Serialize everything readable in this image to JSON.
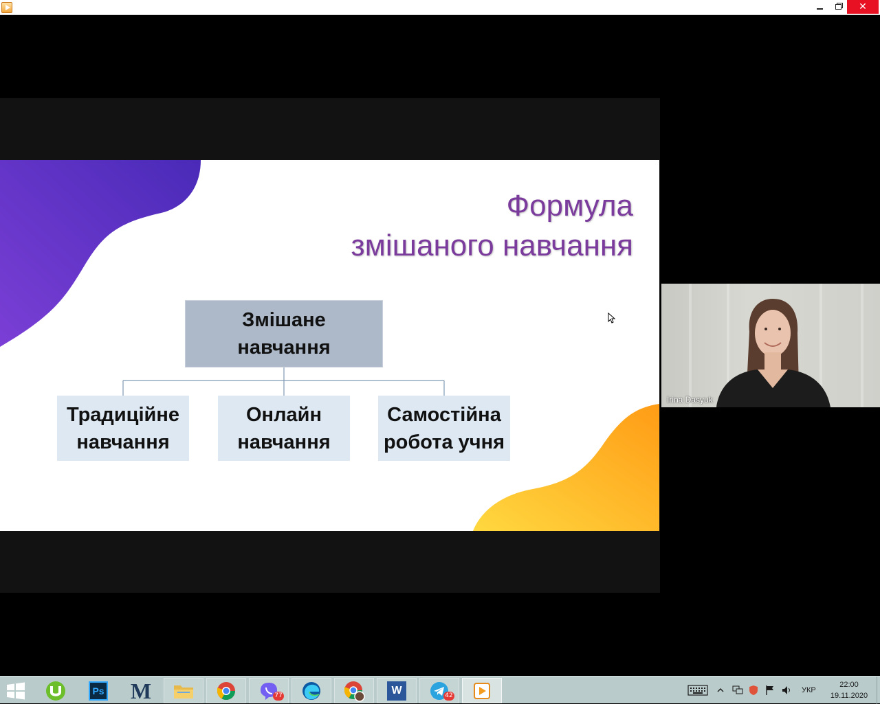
{
  "window": {
    "close_glyph": "✕"
  },
  "slide": {
    "title_line1": "Формула",
    "title_line2": "змішаного навчання",
    "root": {
      "line1": "Змішане",
      "line2": "навчання"
    },
    "children": [
      {
        "line1": "Традиційне",
        "line2": "навчання"
      },
      {
        "line1": "Онлайн",
        "line2": "навчання"
      },
      {
        "line1": "Самостійна",
        "line2": "робота учня"
      }
    ],
    "title_color": "#7a3b9c",
    "blob_purple": [
      "#5b2fc9",
      "#7b3fd6"
    ],
    "blob_orange": [
      "#ffcf3a",
      "#ff9f1a"
    ]
  },
  "webcam": {
    "participant_name": "Irina Dasyuk"
  },
  "taskbar": {
    "apps": [
      {
        "name": "utorrent",
        "badge": ""
      },
      {
        "name": "photoshop",
        "label": "Ps",
        "badge": ""
      },
      {
        "name": "mendeley",
        "label": "M",
        "badge": ""
      },
      {
        "name": "file-explorer",
        "badge": ""
      },
      {
        "name": "chrome",
        "badge": ""
      },
      {
        "name": "viber",
        "badge": "77"
      },
      {
        "name": "edge",
        "badge": ""
      },
      {
        "name": "chrome-profile",
        "badge": ""
      },
      {
        "name": "word",
        "label": "W",
        "badge": ""
      },
      {
        "name": "telegram",
        "badge": "42"
      },
      {
        "name": "video-player",
        "badge": ""
      }
    ],
    "language": "УКР",
    "time": "22:00",
    "date": "19.11.2020"
  }
}
